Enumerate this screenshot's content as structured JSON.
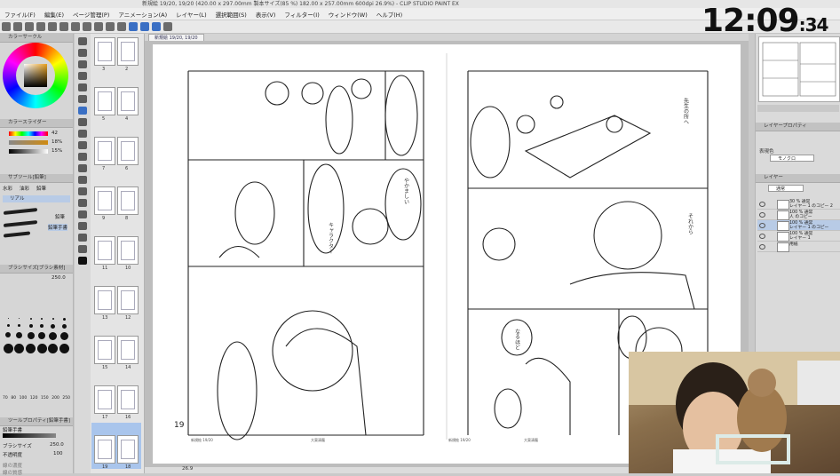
{
  "app": {
    "title": "新規絵 19/20, 19/20 (420.00 x 297.00mm 製本サイズ(85 %) 182.00 x 257.00mm 600dpi 26.9%) - CLIP STUDIO PAINT EX",
    "menus": [
      "ファイル(F)",
      "編集(E)",
      "ページ管理(P)",
      "アニメーション(A)",
      "レイヤー(L)",
      "選択範囲(S)",
      "表示(V)",
      "フィルター(I)",
      "ウィンドウ(W)",
      "ヘルプ(H)"
    ]
  },
  "clock": {
    "main": "12:09",
    "small": ":34"
  },
  "left_panel": {
    "color_wheel_title": "カラーサークル",
    "color_slider_title": "カラースライダー",
    "color_sliders": [
      {
        "value": "42"
      },
      {
        "value": "18%"
      },
      {
        "value": "15%"
      }
    ],
    "subtool_title": "サブツール[鉛筆]",
    "subtool_tabs": [
      "水彩",
      "油彩",
      "鉛筆"
    ],
    "subtool_selected": "リアル",
    "subtool_items": [
      "鉛筆",
      "鉛筆手書"
    ],
    "brush_size_title": "ブラシサイズ[ブラシ素材]",
    "brush_size_value": "250.0",
    "dot_labels": [
      "70",
      "80",
      "100",
      "120",
      "150",
      "200",
      "250"
    ],
    "tool_property_title": "ツールプロパティ[鉛筆手書]",
    "tool_property_name": "鉛筆手書",
    "props": [
      {
        "label": "ブラシサイズ",
        "value": "250.0"
      },
      {
        "label": "不透明度",
        "value": "100"
      },
      {
        "label": "線の濃度",
        "value": ""
      },
      {
        "label": "線の質感",
        "value": ""
      }
    ]
  },
  "thumbnails": {
    "pages": [
      {
        "left": "3",
        "right": "2"
      },
      {
        "left": "5",
        "right": "4"
      },
      {
        "left": "7",
        "right": "6"
      },
      {
        "left": "9",
        "right": "8"
      },
      {
        "left": "11",
        "right": "10"
      },
      {
        "left": "13",
        "right": "12"
      },
      {
        "left": "15",
        "right": "14"
      },
      {
        "left": "17",
        "right": "16"
      },
      {
        "left": "19",
        "right": "18"
      }
    ]
  },
  "canvas": {
    "tab_label": "新規絵 19/20, 19/20",
    "page_number": "19",
    "page_info_left": [
      "新規絵 19/20",
      "大東清龍"
    ],
    "page_info_right": [
      "新規絵 19/20",
      "大東清龍"
    ],
    "zoom_label": "26.9"
  },
  "right_panel": {
    "layer_property_title": "レイヤープロパティ",
    "expression_label": "表現色",
    "expression_value": "モノクロ",
    "layer_title": "レイヤー",
    "blend_mode": "通常",
    "layers": [
      {
        "name1": "30 % 通常",
        "name2": "レイヤー 1 のコピー 2",
        "selected": false
      },
      {
        "name1": "100 % 通常",
        "name2": "人 のコピー",
        "selected": false
      },
      {
        "name1": "100 % 通常",
        "name2": "レイヤー 1 のコピー",
        "selected": true
      },
      {
        "name1": "100 % 通常",
        "name2": "レイヤー 1",
        "selected": false
      },
      {
        "name1": "用紙",
        "name2": "",
        "selected": false
      }
    ]
  }
}
